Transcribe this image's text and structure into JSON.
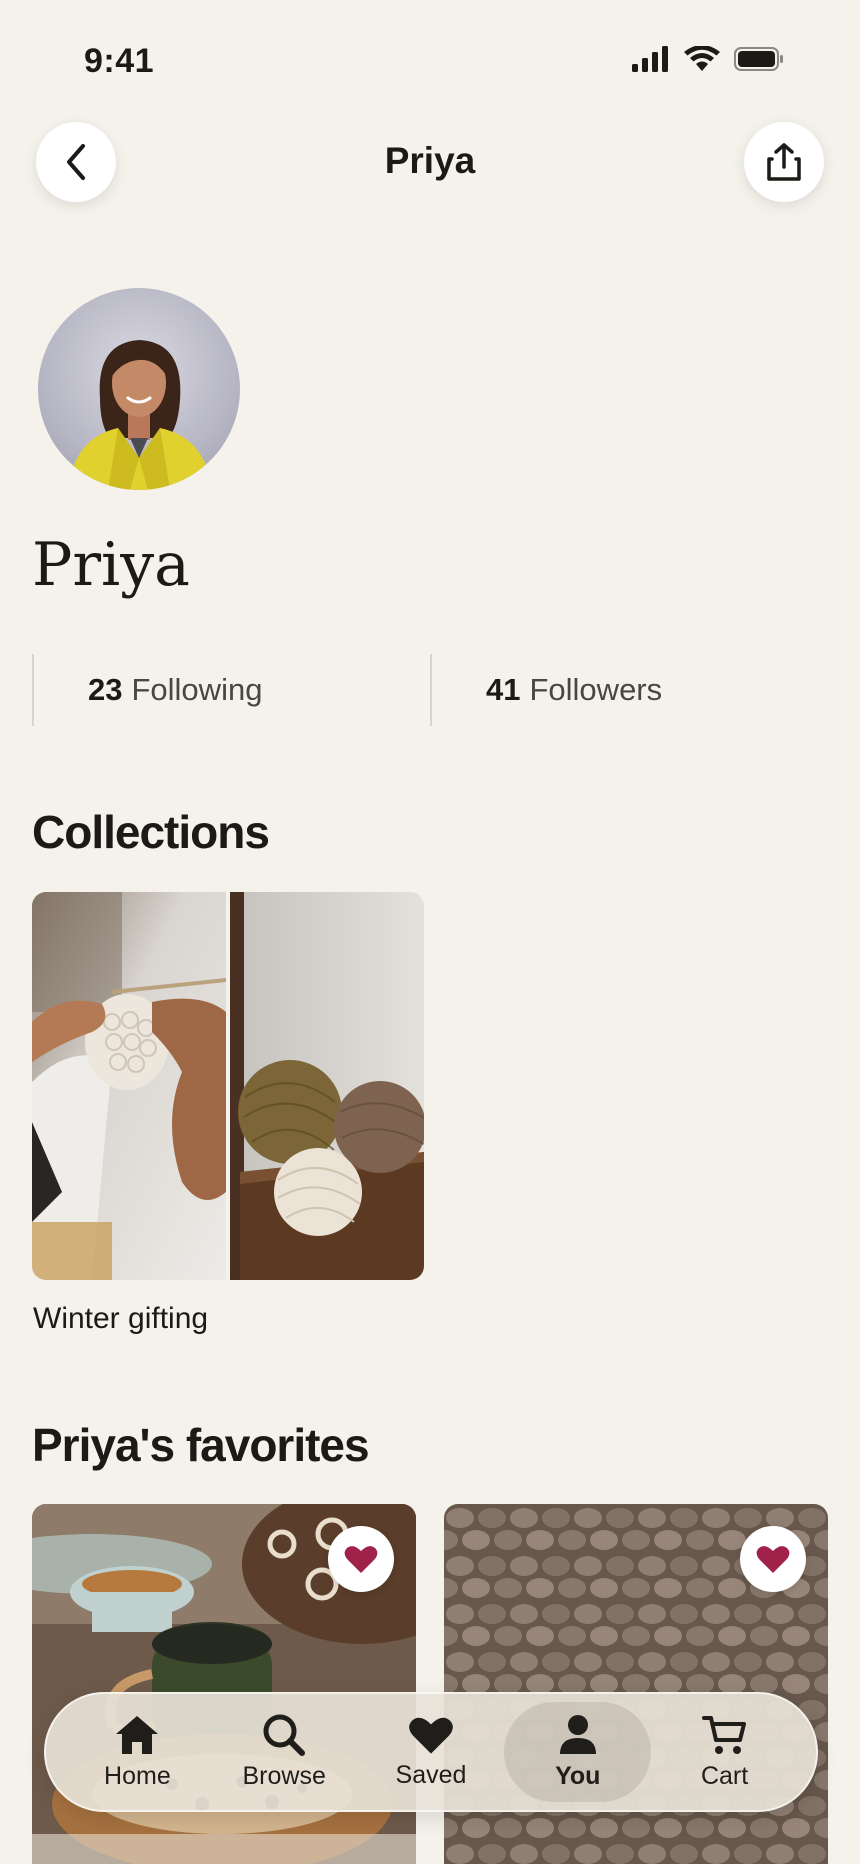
{
  "status_bar": {
    "time": "9:41"
  },
  "header": {
    "title": "Priya"
  },
  "profile": {
    "name": "Priya",
    "stats": [
      {
        "count": "23",
        "label": "Following"
      },
      {
        "count": "41",
        "label": "Followers"
      }
    ]
  },
  "collections": {
    "title": "Collections",
    "items": [
      {
        "label": "Winter gifting"
      }
    ]
  },
  "favorites": {
    "title": "Priya's favorites"
  },
  "tab_bar": {
    "items": [
      {
        "label": "Home",
        "icon": "home-icon"
      },
      {
        "label": "Browse",
        "icon": "search-icon"
      },
      {
        "label": "Saved",
        "icon": "heart-icon"
      },
      {
        "label": "You",
        "icon": "person-icon",
        "active": true
      },
      {
        "label": "Cart",
        "icon": "cart-icon"
      }
    ]
  },
  "colors": {
    "background": "#F5F2EC",
    "heart": "#A0224A",
    "text": "#1B1A17"
  }
}
